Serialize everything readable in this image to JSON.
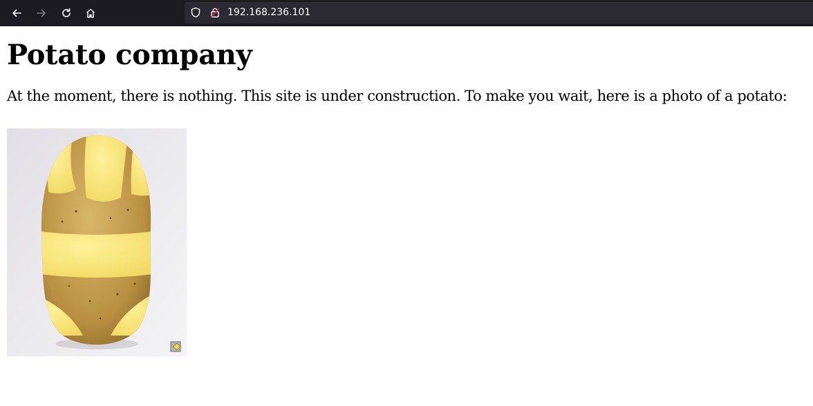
{
  "browser": {
    "url": "192.168.236.101",
    "icons": {
      "back": "arrow-left-icon",
      "forward": "arrow-right-icon",
      "reload": "reload-icon",
      "home": "home-icon",
      "tracking": "shield-icon",
      "security": "lock-warning-icon"
    }
  },
  "page": {
    "heading": "Potato company",
    "message": "At the moment, there is nothing. This site is under construction. To make you wait, here is a photo of a potato:",
    "image_subject": "potato-photo"
  }
}
